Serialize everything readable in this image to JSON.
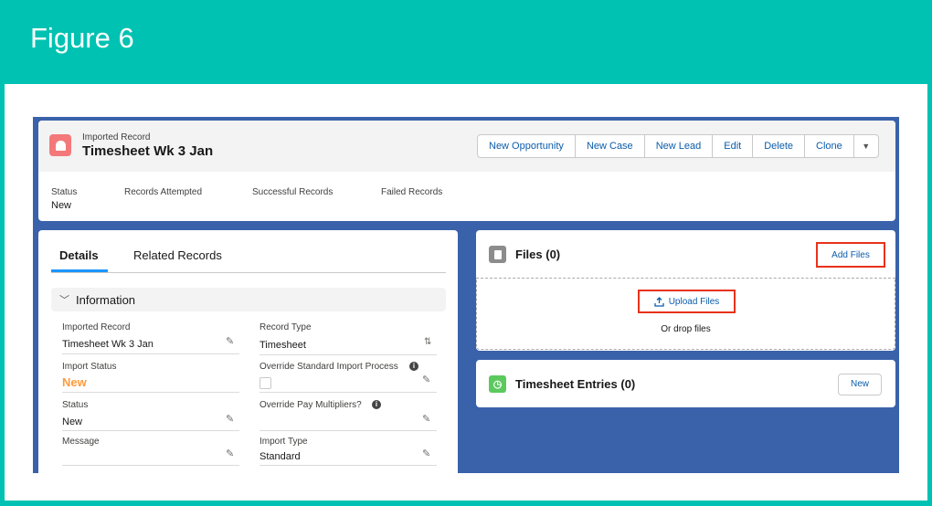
{
  "figure": {
    "title": "Figure 6"
  },
  "header": {
    "record_type": "Imported Record",
    "record_name": "Timesheet Wk 3 Jan",
    "buttons": [
      "New Opportunity",
      "New Case",
      "New Lead",
      "Edit",
      "Delete",
      "Clone"
    ],
    "dropdown_icon": "chevron-down-icon",
    "highlights": [
      {
        "label": "Status",
        "value": "New"
      },
      {
        "label": "Records Attempted",
        "value": ""
      },
      {
        "label": "Successful Records",
        "value": ""
      },
      {
        "label": "Failed Records",
        "value": ""
      }
    ]
  },
  "details": {
    "tabs": [
      "Details",
      "Related Records"
    ],
    "active_tab": "Details",
    "section_title": "Information",
    "fields": {
      "imported_record": {
        "label": "Imported Record",
        "value": "Timesheet Wk 3 Jan"
      },
      "record_type": {
        "label": "Record Type",
        "value": "Timesheet"
      },
      "import_status": {
        "label": "Import Status",
        "value": "New"
      },
      "override_import": {
        "label": "Override Standard Import Process",
        "checked": false
      },
      "status": {
        "label": "Status",
        "value": "New"
      },
      "override_pay": {
        "label": "Override Pay Multipliers?"
      },
      "message": {
        "label": "Message",
        "value": ""
      },
      "import_type": {
        "label": "Import Type",
        "value": "Standard"
      }
    }
  },
  "files": {
    "title": "Files (0)",
    "add_label": "Add Files",
    "upload_label": "Upload Files",
    "drop_text": "Or drop files"
  },
  "timesheet_entries": {
    "title": "Timesheet Entries (0)",
    "new_label": "New"
  },
  "colors": {
    "frame": "#00c2b2",
    "shot_background": "#3a62ab",
    "link": "#0b5cab",
    "highlight_box": "#e8321a",
    "import_status_value": "#ff9a3c",
    "record_icon": "#f4787a",
    "timesheet_icon": "#5bc95e"
  }
}
